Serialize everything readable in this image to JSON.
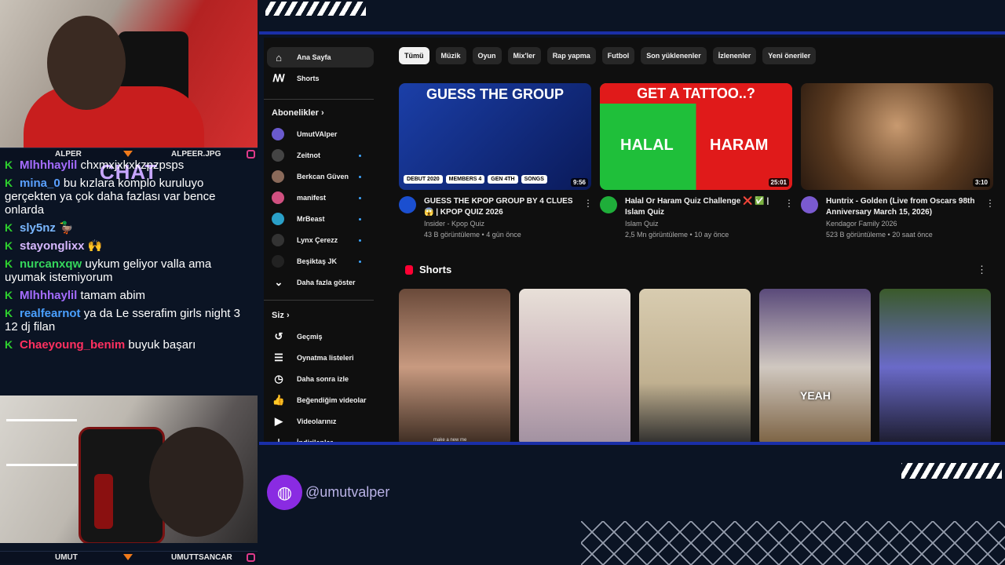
{
  "webcams": {
    "top": {
      "left_label": "ALPER",
      "right_label": "ALPEER.JPG"
    },
    "bottom": {
      "left_label": "UMUT",
      "right_label": "UMUTTSANCAR"
    }
  },
  "chat": {
    "title": "CHAT",
    "messages": [
      {
        "user": "Mlhhhaylil",
        "text": "chxmxjxkxkzpzpsps",
        "color": "#a46cff"
      },
      {
        "user": "mina_0",
        "text": "bu kızlara komplo kuruluyo gerçekten ya çok daha fazlası var bence onlarda",
        "color": "#5aa0ff"
      },
      {
        "user": "sly5nz",
        "text": "🦆",
        "color": "#7ab7ff"
      },
      {
        "user": "stayonglixx",
        "text": "🙌",
        "color": "#d7b8ff"
      },
      {
        "user": "nurcanxqw",
        "text": "uykum geliyor valla ama uyumak istemiyorum",
        "color": "#35d65c"
      },
      {
        "user": "Mlhhhaylil",
        "text": "tamam abim",
        "color": "#a46cff"
      },
      {
        "user": "realfearnot",
        "text": "ya da Le sserafim girls night 3 12 dj filan",
        "color": "#4aa0ff"
      },
      {
        "user": "Chaeyoung_benim",
        "text": "buyuk başarı",
        "color": "#ff3060"
      }
    ]
  },
  "sidebar": {
    "main": [
      {
        "label": "Ana Sayfa",
        "icon": "home-icon"
      },
      {
        "label": "Shorts",
        "icon": "shorts-icon"
      }
    ],
    "subs_header": "Abonelikler",
    "subscriptions": [
      {
        "label": "UmutVAlper",
        "color": "#6a5acd"
      },
      {
        "label": "Zeitnot",
        "color": "#444444"
      },
      {
        "label": "Berkcan Güven",
        "color": "#8a6a5a"
      },
      {
        "label": "manifest",
        "color": "#d05080"
      },
      {
        "label": "MrBeast",
        "color": "#2aa0c8"
      },
      {
        "label": "Lynx Çerezz",
        "color": "#333333"
      },
      {
        "label": "Beşiktaş JK",
        "color": "#222222"
      }
    ],
    "show_more": "Daha fazla göster",
    "you_header": "Siz",
    "you_items": [
      {
        "label": "Geçmiş",
        "icon": "history-icon"
      },
      {
        "label": "Oynatma listeleri",
        "icon": "playlist-icon"
      },
      {
        "label": "Daha sonra izle",
        "icon": "clock-icon"
      },
      {
        "label": "Beğendiğim videolar",
        "icon": "like-icon"
      },
      {
        "label": "Videolarınız",
        "icon": "video-icon"
      },
      {
        "label": "İndirilenler",
        "icon": "download-icon"
      }
    ]
  },
  "chips": [
    "Tümü",
    "Müzik",
    "Oyun",
    "Mix'ler",
    "Rap yapma",
    "Futbol",
    "Son yüklenenler",
    "İzlenenler",
    "Yeni öneriler"
  ],
  "videos": [
    {
      "title": "GUESS THE KPOP GROUP BY 4 CLUES 😱 | KPOP QUIZ 2026",
      "channel": "Insider - Kpop Quiz",
      "stats": "43 B görüntüleme • 4 gün önce",
      "duration": "9:56",
      "thumb_text": "GUESS THE GROUP",
      "thumb_facts": [
        "DEBUT 2020",
        "MEMBERS 4",
        "GEN 4TH",
        "SONGS"
      ]
    },
    {
      "title": "Halal Or Haram Quiz Challenge ❌ ✅ | Islam Quiz",
      "channel": "Islam Quiz",
      "stats": "2,5 Mn görüntüleme • 10 ay önce",
      "duration": "25:01",
      "thumb_text": "GET A TATTOO..?",
      "left": "HALAL",
      "right": "HARAM"
    },
    {
      "title": "Huntrix - Golden (Live from Oscars 98th Anniversary March 15, 2026)",
      "channel": "Kendagor Family 2026",
      "stats": "523 B görüntüleme • 20 saat önce",
      "duration": "3:10"
    }
  ],
  "shorts": {
    "title": "Shorts",
    "items": [
      {
        "caption": "make a new me"
      },
      {
        "caption": ""
      },
      {
        "caption": ""
      },
      {
        "caption": "YEAH"
      },
      {
        "caption": ""
      }
    ]
  },
  "handle": "@umutvalper"
}
